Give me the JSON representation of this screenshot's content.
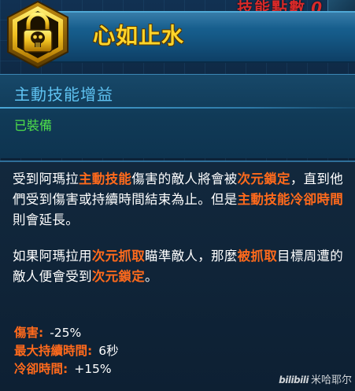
{
  "top_counter": {
    "label": "技能點數",
    "value": "0"
  },
  "skill": {
    "name": "心如止水",
    "type": "主動技能增益",
    "status": "已裝備",
    "icon": "skull-padlock-icon"
  },
  "description": {
    "p1": [
      {
        "text": "受到阿瑪拉",
        "hl": false
      },
      {
        "text": "主動技能",
        "hl": true
      },
      {
        "text": "傷害的敵人將會被",
        "hl": false
      },
      {
        "text": "次元鎖定",
        "hl": true
      },
      {
        "text": "，直到他們受到傷害或持續時間結束為止。但是",
        "hl": false
      },
      {
        "text": "主動技能冷卻時間",
        "hl": true
      },
      {
        "text": "則會延長。",
        "hl": false
      }
    ],
    "p2": [
      {
        "text": "如果阿瑪拉用",
        "hl": false
      },
      {
        "text": "次元抓取",
        "hl": true
      },
      {
        "text": "瞄準敵人，那麼",
        "hl": false
      },
      {
        "text": "被抓取",
        "hl": true
      },
      {
        "text": "目標周遭的敵人便會受到",
        "hl": false
      },
      {
        "text": "次元鎖定",
        "hl": true
      },
      {
        "text": "。",
        "hl": false
      }
    ]
  },
  "stats": [
    {
      "label": "傷害:",
      "value": "-25%"
    },
    {
      "label": "最大持續時間:",
      "value": "6秒"
    },
    {
      "label": "冷卻時間:",
      "value": "+15%"
    }
  ],
  "watermark": {
    "logo": "bilibili",
    "user": "米哈耶尔"
  },
  "colors": {
    "title": "#ffd52a",
    "skill_type": "#5fc3f2",
    "equipped": "#4fe04a",
    "highlight": "#ff6a1c",
    "counter": "#d82a2a"
  }
}
